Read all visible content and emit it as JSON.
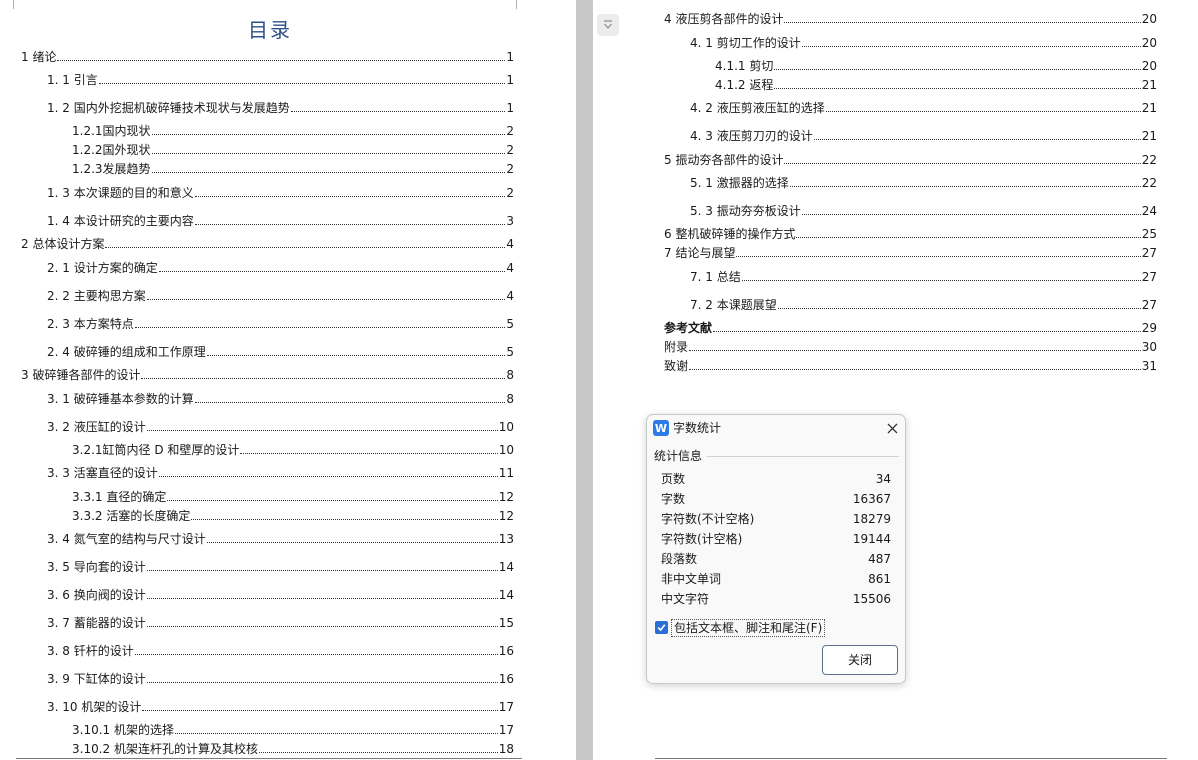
{
  "toc_title": "目录",
  "toc_left": [
    {
      "label": "1 绪论",
      "page": "1",
      "level": 0,
      "bold": false
    },
    {
      "label": "1. 1 引言",
      "page": "1",
      "level": 1,
      "bold": false
    },
    {
      "label": "1. 2 国内外挖掘机破碎锤技术现状与发展趋势",
      "page": "1",
      "level": 1,
      "bold": false
    },
    {
      "label": "1.2.1国内现状",
      "page": "2",
      "level": 2,
      "bold": false
    },
    {
      "label": "1.2.2国外现状",
      "page": "2",
      "level": 2,
      "bold": false
    },
    {
      "label": "1.2.3发展趋势",
      "page": "2",
      "level": 2,
      "bold": false
    },
    {
      "label": "1. 3 本次课题的目的和意义",
      "page": "2",
      "level": 1,
      "bold": false
    },
    {
      "label": "1. 4 本设计研究的主要内容",
      "page": "3",
      "level": 1,
      "bold": false
    },
    {
      "label": "2 总体设计方案",
      "page": "4",
      "level": 0,
      "bold": false
    },
    {
      "label": "2. 1 设计方案的确定",
      "page": "4",
      "level": 1,
      "bold": false
    },
    {
      "label": "2. 2 主要构思方案",
      "page": "4",
      "level": 1,
      "bold": false
    },
    {
      "label": "2. 3 本方案特点",
      "page": "5",
      "level": 1,
      "bold": false
    },
    {
      "label": "2. 4 破碎锤的组成和工作原理",
      "page": "5",
      "level": 1,
      "bold": false
    },
    {
      "label": "3 破碎锤各部件的设计",
      "page": "8",
      "level": 0,
      "bold": false
    },
    {
      "label": "3. 1 破碎锤基本参数的计算",
      "page": "8",
      "level": 1,
      "bold": false
    },
    {
      "label": "3. 2 液压缸的设计",
      "page": "10",
      "level": 1,
      "bold": false
    },
    {
      "label": "3.2.1缸筒内径 D 和壁厚的设计",
      "page": "10",
      "level": 2,
      "bold": false
    },
    {
      "label": "3. 3 活塞直径的设计",
      "page": "11",
      "level": 1,
      "bold": false
    },
    {
      "label": "3.3.1 直径的确定",
      "page": "12",
      "level": 2,
      "bold": false
    },
    {
      "label": "3.3.2 活塞的长度确定",
      "page": "12",
      "level": 2,
      "bold": false
    },
    {
      "label": "3. 4 氮气室的结构与尺寸设计",
      "page": "13",
      "level": 1,
      "bold": false
    },
    {
      "label": "3. 5 导向套的设计",
      "page": "14",
      "level": 1,
      "bold": false
    },
    {
      "label": "3. 6 换向阀的设计",
      "page": "14",
      "level": 1,
      "bold": false
    },
    {
      "label": "3. 7 蓄能器的设计",
      "page": "15",
      "level": 1,
      "bold": false
    },
    {
      "label": "3. 8 钎杆的设计",
      "page": "16",
      "level": 1,
      "bold": false
    },
    {
      "label": "3. 9 下缸体的设计",
      "page": "16",
      "level": 1,
      "bold": false
    },
    {
      "label": "3. 10 机架的设计",
      "page": "17",
      "level": 1,
      "bold": false
    },
    {
      "label": "3.10.1 机架的选择",
      "page": "17",
      "level": 2,
      "bold": false
    },
    {
      "label": "3.10.2 机架连杆孔的计算及其校核",
      "page": "18",
      "level": 2,
      "bold": false
    }
  ],
  "toc_right": [
    {
      "label": "4 液压剪各部件的设计",
      "page": "20",
      "level": 0,
      "bold": false
    },
    {
      "label": "4. 1 剪切工作的设计",
      "page": "20",
      "level": 1,
      "bold": false
    },
    {
      "label": "4.1.1 剪切",
      "page": "20",
      "level": 2,
      "bold": false
    },
    {
      "label": "4.1.2 返程",
      "page": "21",
      "level": 2,
      "bold": false
    },
    {
      "label": "4. 2 液压剪液压缸的选择",
      "page": "21",
      "level": 1,
      "bold": false
    },
    {
      "label": "4. 3 液压剪刀刃的设计",
      "page": "21",
      "level": 1,
      "bold": false
    },
    {
      "label": "5 振动夯各部件的设计",
      "page": "22",
      "level": 0,
      "bold": false
    },
    {
      "label": "5. 1 激振器的选择",
      "page": "22",
      "level": 1,
      "bold": false
    },
    {
      "label": "5. 3 振动夯夯板设计",
      "page": "24",
      "level": 1,
      "bold": false
    },
    {
      "label": "6 整机破碎锤的操作方式",
      "page": "25",
      "level": 0,
      "bold": false
    },
    {
      "label": "7 结论与展望",
      "page": "27",
      "level": 0,
      "bold": false
    },
    {
      "label": "7. 1 总结",
      "page": "27",
      "level": 1,
      "bold": false
    },
    {
      "label": "7. 2 本课题展望",
      "page": "27",
      "level": 1,
      "bold": false
    },
    {
      "label": "参考文献",
      "page": "29",
      "level": 0,
      "bold": true
    },
    {
      "label": "附录",
      "page": "30",
      "level": 0,
      "bold": false
    },
    {
      "label": "致谢",
      "page": "31",
      "level": 0,
      "bold": false
    }
  ],
  "dialog": {
    "icon_text": "W",
    "title": "字数统计",
    "section_label": "统计信息",
    "stats": [
      {
        "label": "页数",
        "value": "34"
      },
      {
        "label": "字数",
        "value": "16367"
      },
      {
        "label": "字符数(不计空格)",
        "value": "18279"
      },
      {
        "label": "字符数(计空格)",
        "value": "19144"
      },
      {
        "label": "段落数",
        "value": "487"
      },
      {
        "label": "非中文单词",
        "value": "861"
      },
      {
        "label": "中文字符",
        "value": "15506"
      }
    ],
    "checkbox_label": "包括文本框、脚注和尾注(F)",
    "checkbox_checked": true,
    "close_button_label": "关闭"
  }
}
